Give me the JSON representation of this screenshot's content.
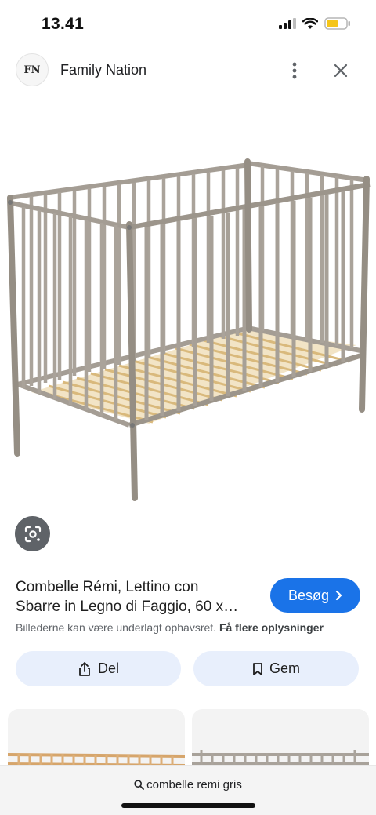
{
  "status": {
    "time": "13.41"
  },
  "source": {
    "logo_text": "FN",
    "name": "Family Nation"
  },
  "result": {
    "title_line1": "Combelle Rémi, Lettino con",
    "title_line2": "Sbarre in Legno di Faggio, 60 x…",
    "visit_label": "Besøg",
    "copyright_text": "Billederne kan være underlagt ophavsret.",
    "more_info_label": "Få flere oplysninger",
    "share_label": "Del",
    "save_label": "Gem"
  },
  "search": {
    "query": "combelle remi gris"
  },
  "colors": {
    "accent": "#1a73e8",
    "button_bg": "#e8effc",
    "crib_frame": "#9f988e",
    "slats": "#d9b97c"
  },
  "icons": [
    "signal-icon",
    "wifi-icon",
    "battery-icon",
    "more-vert-icon",
    "close-icon",
    "lens-icon",
    "chevron-right-icon",
    "share-icon",
    "bookmark-icon",
    "search-icon"
  ]
}
